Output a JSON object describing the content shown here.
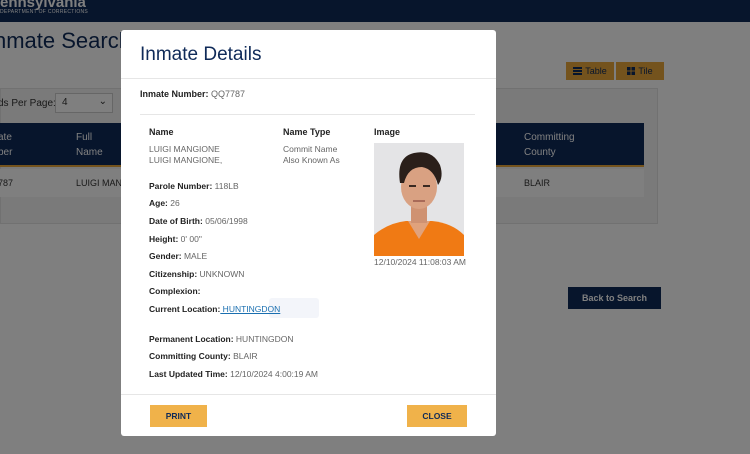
{
  "background": {
    "brand_name": "ennsylvania",
    "brand_sub": "DEPARTMENT OF CORRECTIONS",
    "page_title": "nmate Search Re",
    "records_per_page_label": "ds Per Page:",
    "records_per_page_value": "4",
    "view_table_label": "Table",
    "view_tile_label": "Tile",
    "table_headers": [
      {
        "line1": "ate",
        "line2": "ber"
      },
      {
        "line1": "Full",
        "line2": "Name"
      },
      {
        "line1": "Committing",
        "line2": "County"
      }
    ],
    "table_row": {
      "number": "787",
      "name": "LUIGI MAN",
      "county": "BLAIR"
    },
    "back_button": "Back to Search"
  },
  "modal": {
    "title": "Inmate Details",
    "inmate_number_label": "Inmate Number:",
    "inmate_number": "QQ7787",
    "name_header": "Name",
    "name_type_header": "Name Type",
    "image_header": "Image",
    "names": [
      {
        "name": "LUIGI MANGIONE",
        "type": "Commit Name"
      },
      {
        "name": "LUIGI MANGIONE,",
        "type": "Also Known As"
      }
    ],
    "image_timestamp": "12/10/2024 11:08:03 AM",
    "fields": {
      "parole_number_label": "Parole Number:",
      "parole_number": "118LB",
      "age_label": "Age:",
      "age": "26",
      "dob_label": "Date of Birth:",
      "dob": "05/06/1998",
      "height_label": "Height:",
      "height": "0' 00\"",
      "gender_label": "Gender:",
      "gender": "MALE",
      "citizenship_label": "Citizenship:",
      "citizenship": "UNKNOWN",
      "complexion_label": "Complexion:",
      "complexion": "",
      "current_location_label": "Current Location:",
      "current_location": " HUNTINGDON",
      "permanent_location_label": "Permanent Location:",
      "permanent_location": "HUNTINGDON",
      "committing_county_label": "Committing County:",
      "committing_county": "BLAIR",
      "last_updated_label": "Last Updated Time:",
      "last_updated": "12/10/2024 4:00:19 AM"
    },
    "print_button": "PRINT",
    "close_button": "CLOSE"
  },
  "colors": {
    "navy": "#0f2a58",
    "gold": "#f0b24a",
    "link": "#1a6fb0"
  },
  "icons": [
    "table-icon",
    "tile-icon",
    "chevron-down-icon"
  ]
}
